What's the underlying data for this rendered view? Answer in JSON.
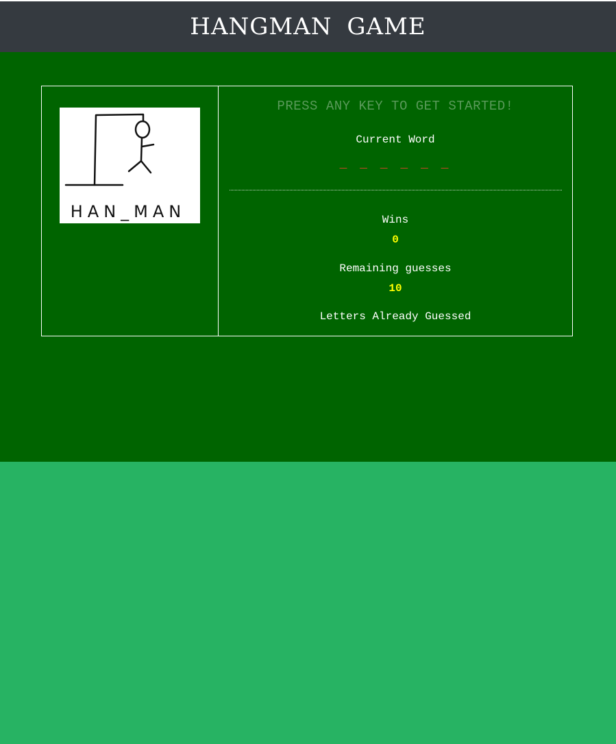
{
  "header": {
    "title": "HANGMAN GAME"
  },
  "image": {
    "icon": "hangman-drawing",
    "caption": "HAN_MAN"
  },
  "game": {
    "prompt": "PRESS ANY KEY TO GET STARTED!",
    "current_word_label": "Current Word",
    "current_word": "_ _ _ _ _ _",
    "wins_label": "Wins",
    "wins_value": "0",
    "remaining_label": "Remaining guesses",
    "remaining_value": "10",
    "letters_label": "Letters Already Guessed"
  },
  "colors": {
    "header_bg": "#353a40",
    "main_bg": "#006400",
    "page_bg": "#27b363",
    "word_color": "#e0442a",
    "value_color": "#ffff00"
  }
}
